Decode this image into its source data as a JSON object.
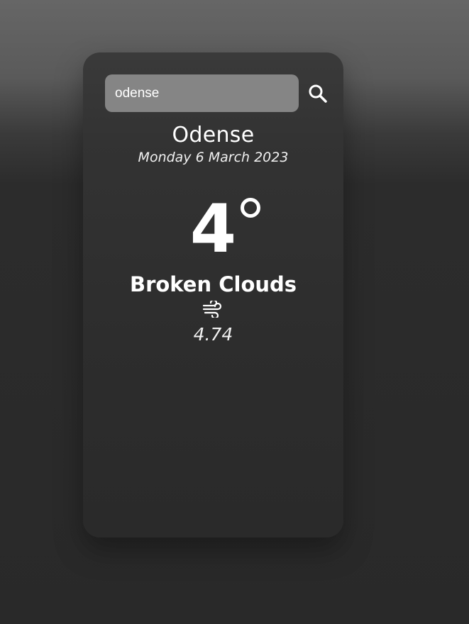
{
  "search": {
    "value": "odense",
    "icon": "search-icon"
  },
  "location": {
    "city": "Odense",
    "date": "Monday 6 March 2023"
  },
  "weather": {
    "temperature": "4",
    "condition": "Broken Clouds",
    "wind_icon": "wind-icon",
    "wind_speed": "4.74"
  },
  "colors": {
    "text": "#ffffff",
    "input_background": "#858585",
    "card_background": "#333333"
  }
}
